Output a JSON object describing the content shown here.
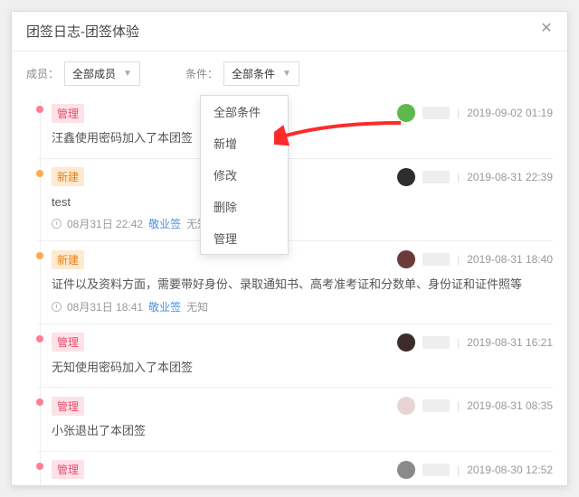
{
  "header": {
    "title": "团签日志-团签体验"
  },
  "filters": {
    "member_label": "成员：",
    "member_value": "全部成员",
    "condition_label": "条件：",
    "condition_value": "全部条件"
  },
  "dropdown": {
    "items": [
      "全部条件",
      "新增",
      "修改",
      "删除",
      "管理"
    ]
  },
  "entries": [
    {
      "dot": "pink",
      "tag_class": "pink",
      "tag": "管理",
      "avatar_color": "#5fb84e",
      "timestamp": "2019-09-02 01:19",
      "body": "汪鑫使用密码加入了本团签"
    },
    {
      "dot": "orange",
      "tag_class": "orange",
      "tag": "新建",
      "avatar_color": "#2e2e2e",
      "timestamp": "2019-08-31 22:39",
      "body": "test",
      "footer_time": "08月31日 22:42",
      "footer_link": "敬业签",
      "footer_after": "无知"
    },
    {
      "dot": "orange",
      "tag_class": "orange",
      "tag": "新建",
      "avatar_color": "#6b3a3a",
      "timestamp": "2019-08-31 18:40",
      "body": "证件以及资料方面，需要带好身份、录取通知书、高考准考证和分数单、身份证和证件照等",
      "footer_time": "08月31日 18:41",
      "footer_link": "敬业签",
      "footer_after": "无知"
    },
    {
      "dot": "pink",
      "tag_class": "pink",
      "tag": "管理",
      "avatar_color": "#3d2b2b",
      "timestamp": "2019-08-31 16:21",
      "body": "无知使用密码加入了本团签"
    },
    {
      "dot": "pink",
      "tag_class": "pink",
      "tag": "管理",
      "avatar_color": "#e7d5d5",
      "timestamp": "2019-08-31 08:35",
      "body": "小张退出了本团签"
    },
    {
      "dot": "pink",
      "tag_class": "pink",
      "tag": "管理",
      "avatar_color": "#8a8a8a",
      "timestamp": "2019-08-30 12:52"
    }
  ]
}
